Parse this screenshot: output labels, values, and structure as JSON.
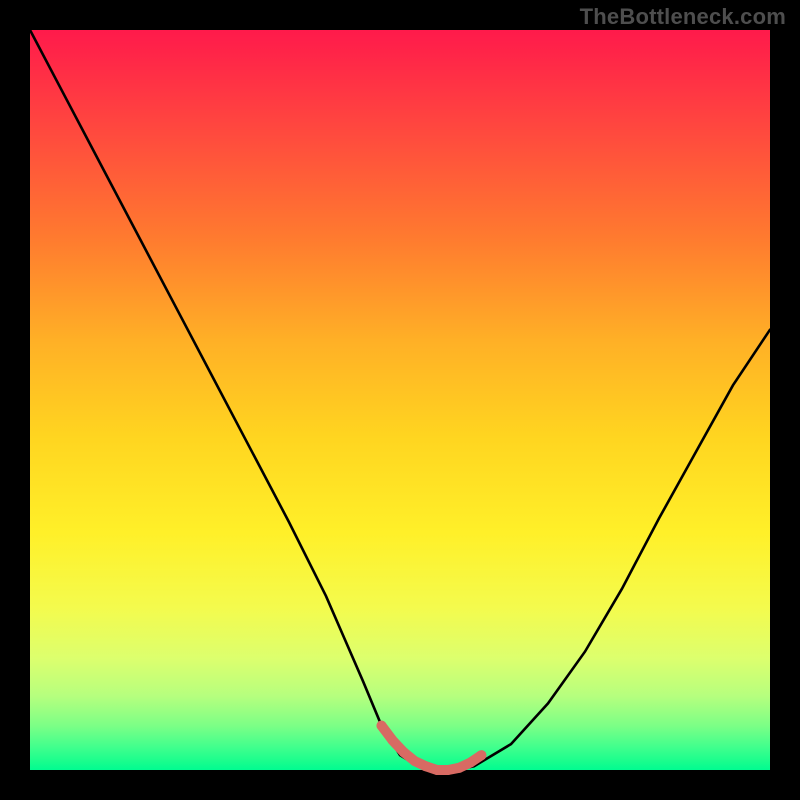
{
  "watermark": "TheBottleneck.com",
  "colors": {
    "frame": "#000000",
    "curve": "#000000",
    "marker": "#d86a63",
    "gradient_top": "#ff1a4b",
    "gradient_bottom": "#00fc91",
    "watermark_text": "#4e4e4e"
  },
  "chart_data": {
    "type": "line",
    "title": "",
    "xlabel": "",
    "ylabel": "",
    "xlim": [
      0,
      1
    ],
    "ylim": [
      0,
      1
    ],
    "series": [
      {
        "name": "bottleneck-curve",
        "x": [
          0.0,
          0.05,
          0.1,
          0.15,
          0.2,
          0.25,
          0.3,
          0.35,
          0.4,
          0.45,
          0.475,
          0.5,
          0.525,
          0.55,
          0.575,
          0.6,
          0.65,
          0.7,
          0.75,
          0.8,
          0.85,
          0.9,
          0.95,
          1.0
        ],
        "y": [
          1.0,
          0.905,
          0.81,
          0.715,
          0.62,
          0.525,
          0.43,
          0.335,
          0.235,
          0.12,
          0.06,
          0.02,
          0.005,
          0.0,
          0.0,
          0.005,
          0.035,
          0.09,
          0.16,
          0.245,
          0.34,
          0.43,
          0.52,
          0.595
        ]
      }
    ],
    "highlight": {
      "name": "bottom-segment",
      "x": [
        0.475,
        0.49,
        0.505,
        0.52,
        0.535,
        0.55,
        0.565,
        0.58,
        0.595,
        0.61
      ],
      "y": [
        0.06,
        0.04,
        0.024,
        0.012,
        0.005,
        0.0,
        0.0,
        0.003,
        0.01,
        0.02
      ]
    },
    "background_gradient_stops": [
      {
        "pos": 0.0,
        "color": "#ff1a4b"
      },
      {
        "pos": 0.14,
        "color": "#ff4a3e"
      },
      {
        "pos": 0.28,
        "color": "#ff7a2f"
      },
      {
        "pos": 0.42,
        "color": "#ffb026"
      },
      {
        "pos": 0.55,
        "color": "#ffd520"
      },
      {
        "pos": 0.68,
        "color": "#fff029"
      },
      {
        "pos": 0.78,
        "color": "#f4fb4d"
      },
      {
        "pos": 0.85,
        "color": "#dcff6e"
      },
      {
        "pos": 0.9,
        "color": "#b6ff7e"
      },
      {
        "pos": 0.94,
        "color": "#7cff86"
      },
      {
        "pos": 0.97,
        "color": "#3fff8d"
      },
      {
        "pos": 0.99,
        "color": "#16fd8d"
      },
      {
        "pos": 1.0,
        "color": "#00fc91"
      }
    ]
  }
}
